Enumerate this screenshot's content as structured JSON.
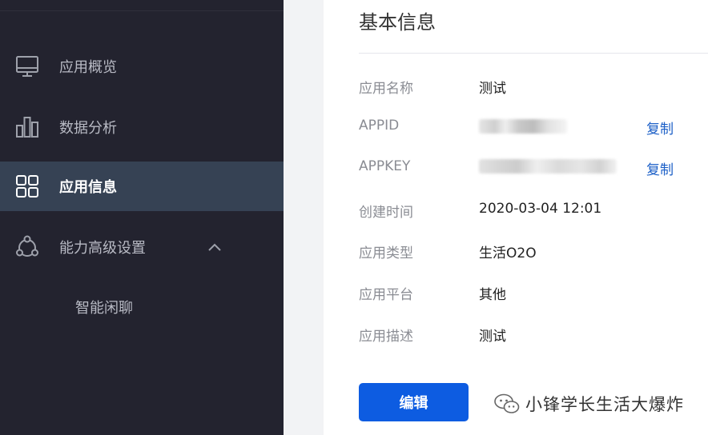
{
  "sidebar": {
    "items": [
      {
        "label": "应用概览",
        "icon": "monitor-icon"
      },
      {
        "label": "数据分析",
        "icon": "bar-chart-icon"
      },
      {
        "label": "应用信息",
        "icon": "grid-icon",
        "active": true
      },
      {
        "label": "能力高级设置",
        "icon": "network-icon",
        "expanded": true
      }
    ],
    "sub_items": [
      {
        "label": "智能闲聊"
      }
    ]
  },
  "main": {
    "section_title": "基本信息",
    "fields": {
      "app_name": {
        "label": "应用名称",
        "value": "测试"
      },
      "appid": {
        "label": "APPID",
        "action": "复制"
      },
      "appkey": {
        "label": "APPKEY",
        "action": "复制"
      },
      "created": {
        "label": "创建时间",
        "value": "2020-03-04 12:01"
      },
      "type": {
        "label": "应用类型",
        "value": "生活O2O"
      },
      "platform": {
        "label": "应用平台",
        "value": "其他"
      },
      "description": {
        "label": "应用描述",
        "value": "测试"
      }
    },
    "edit_label": "编辑"
  },
  "watermark": {
    "text": "小锋学长生活大爆炸",
    "icon": "wechat-icon"
  },
  "colors": {
    "sidebar_bg": "#23232f",
    "sidebar_active": "#364254",
    "primary": "#0d5ce1",
    "link": "#1b5fc7"
  }
}
